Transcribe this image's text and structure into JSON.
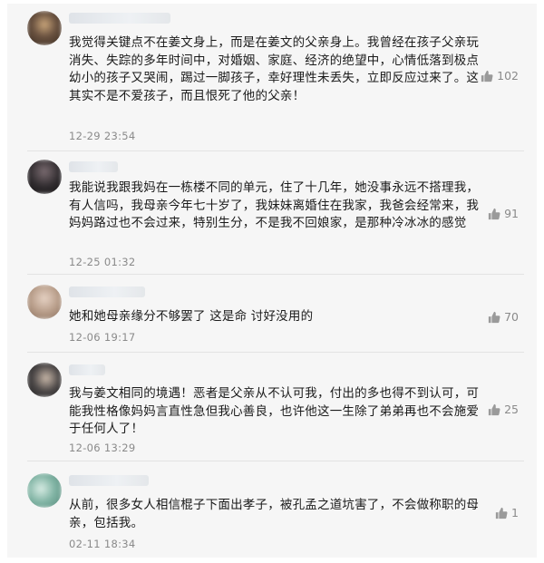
{
  "comments": [
    {
      "text": "我觉得关键点不在姜文身上，而是在姜文的父亲身上。我曾经在孩子父亲玩消失、失踪的多年时间中，对婚姻、家庭、经济的绝望中，心情低落到极点幼小的孩子又哭闹，踢过一脚孩子，幸好理性未丢失，立即反应过来了。这其实不是不爱孩子，而且恨死了他的父亲！",
      "time": "12-29 23:54",
      "likes": "102",
      "avatar_color": "#5a4636"
    },
    {
      "text": "我能说我跟我妈在一栋楼不同的单元，住了十几年，她没事永远不搭理我，有人信吗，我母亲今年七十岁了，我妹妹离婚住在我家，我爸会经常来，我妈妈路过也不会过来，特别生分，不是我不回娘家，是那种冷冰冰的感觉",
      "time": "12-25 01:32",
      "likes": "91",
      "avatar_color": "#2e2a2d"
    },
    {
      "text": "她和她母亲缘分不够罢了 这是命 讨好没用的",
      "time": "12-06 19:17",
      "likes": "70",
      "avatar_color": "#b59a86"
    },
    {
      "text": "我与姜文相同的境遇！恶者是父亲从不认可我，付出的多也得不到认可，可能我性格像妈妈言直性急但我心善良，也许他这一生除了弟弟再也不会施爱于任何人了！",
      "time": "12-06 13:29",
      "likes": "25",
      "avatar_color": "#3a3a3a"
    },
    {
      "text": "从前，很多女人相信棍子下面出孝子，被孔孟之道坑害了，不会做称职的母亲，包括我。",
      "time": "02-11 18:34",
      "likes": "1",
      "avatar_color": "#7fb3a3"
    }
  ]
}
